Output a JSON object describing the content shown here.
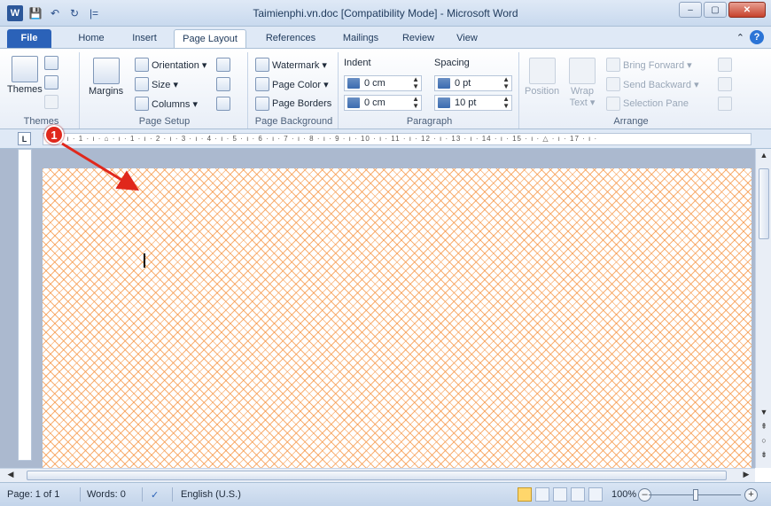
{
  "window": {
    "title": "Taimienphi.vn.doc [Compatibility Mode] - Microsoft Word",
    "minimize": "–",
    "maximize": "▢",
    "close": "✕"
  },
  "qat": {
    "logo": "W",
    "save": "💾",
    "undo": "↶",
    "redo": "↻",
    "customize": "|="
  },
  "tabs": [
    "File",
    "Home",
    "Insert",
    "Page Layout",
    "References",
    "Mailings",
    "Review",
    "View"
  ],
  "active_tab": "Page Layout",
  "help": {
    "collapse": "⌃",
    "help": "?"
  },
  "ribbon": {
    "themes": {
      "themes_label": "Themes",
      "group_label": "Themes"
    },
    "page_setup": {
      "margins": "Margins",
      "orientation": "Orientation ▾",
      "size": "Size ▾",
      "columns": "Columns ▾",
      "group_label": "Page Setup"
    },
    "page_background": {
      "watermark": "Watermark ▾",
      "page_color": "Page Color ▾",
      "page_borders": "Page Borders",
      "group_label": "Page Background"
    },
    "paragraph": {
      "indent_label": "Indent",
      "spacing_label": "Spacing",
      "indent_left": "0 cm",
      "indent_right": "0 cm",
      "spacing_before": "0 pt",
      "spacing_after": "10 pt",
      "group_label": "Paragraph"
    },
    "arrange": {
      "position": "Position",
      "wrap_text": "Wrap\nText ▾",
      "bring_forward": "Bring Forward ▾",
      "send_backward": "Send Backward ▾",
      "selection_pane": "Selection Pane",
      "group_label": "Arrange"
    }
  },
  "ruler": {
    "tab_selector": "L",
    "scale": "· 2 · ı · 1 · ı · ⌂ · ı · 1 · ı · 2 · ı · 3 · ı · 4 · ı · 5 · ı · 6 · ı · 7 · ı · 8 · ı · 9 · ı · 10 · ı · 11 · ı · 12 · ı · 13 · ı · 14 · ı · 15 · ı · △ · ı · 17 · ı ·"
  },
  "annotation": {
    "marker": "1"
  },
  "status": {
    "page": "Page: 1 of 1",
    "words": "Words: 0",
    "language": "English (U.S.)",
    "zoom": "100%",
    "zoom_out": "–",
    "zoom_in": "+"
  },
  "colors": {
    "page_pattern": "#f6964a",
    "file_tab": "#2b62b8",
    "marker": "#e0281c"
  }
}
